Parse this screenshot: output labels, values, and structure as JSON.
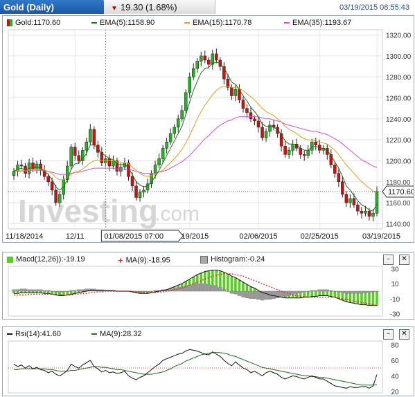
{
  "header": {
    "title": "Gold (Daily)",
    "change": "19.30 (1.68%)",
    "datetime": "03/19/2015 08:55:43"
  },
  "main_chart": {
    "legend": [
      {
        "label": "Gold:1170.60",
        "color": "#2a8b2a"
      },
      {
        "label": "EMA(5):1158.90",
        "color": "#1f6b1f"
      },
      {
        "label": "EMA(15):1170.78",
        "color": "#d8a020"
      },
      {
        "label": "EMA(35):1193.67",
        "color": "#d050d8"
      }
    ],
    "watermark": "Investing",
    "watermark_suffix": ".com",
    "last_price_label": "1170.60",
    "crosshair_label": "01/08/2015 07:00"
  },
  "macd": {
    "legend": [
      {
        "label": "Macd(12,26)):-19.19"
      },
      {
        "label": "MA(9):-18.95"
      },
      {
        "label": "Histogram:-0.24"
      }
    ]
  },
  "rsi": {
    "legend": [
      {
        "label": "Rsi(14):41.60"
      },
      {
        "label": "MA(9):28.32"
      }
    ]
  },
  "controls": {
    "minimize": "–",
    "close": "✕"
  },
  "colors": {
    "up": "#22b322",
    "down": "#d01010",
    "ema5": "#1f6b1f",
    "ema15": "#d8a020",
    "ema35": "#d050d8",
    "macd_hist": "#55d020",
    "signal": "#e03030"
  },
  "chart_data": [
    {
      "type": "candlestick",
      "title": "Gold (Daily)",
      "x_tick_labels": [
        "11/18/2014",
        "12/11",
        "01/19/2015",
        "02/06/2015",
        "02/25/2015",
        "03/19/2015"
      ],
      "ylim": [
        1135,
        1325
      ],
      "y_ticks": [
        1140,
        1160,
        1180,
        1200,
        1220,
        1240,
        1260,
        1280,
        1300,
        1320
      ],
      "close": [
        1190,
        1196,
        1195,
        1188,
        1198,
        1192,
        1197,
        1191,
        1185,
        1180,
        1172,
        1160,
        1168,
        1182,
        1195,
        1213,
        1205,
        1200,
        1210,
        1218,
        1230,
        1215,
        1208,
        1198,
        1202,
        1195,
        1200,
        1190,
        1194,
        1198,
        1185,
        1176,
        1165,
        1170,
        1172,
        1178,
        1188,
        1196,
        1202,
        1212,
        1218,
        1226,
        1232,
        1240,
        1248,
        1265,
        1280,
        1288,
        1295,
        1300,
        1296,
        1292,
        1302,
        1296,
        1290,
        1278,
        1270,
        1262,
        1268,
        1258,
        1250,
        1246,
        1240,
        1238,
        1232,
        1222,
        1228,
        1234,
        1232,
        1226,
        1214,
        1206,
        1210,
        1216,
        1212,
        1206,
        1205,
        1210,
        1218,
        1215,
        1210,
        1212,
        1206,
        1196,
        1188,
        1180,
        1168,
        1160,
        1164,
        1158,
        1152,
        1150,
        1152,
        1147,
        1150,
        1170.6
      ],
      "ema5": [
        1190,
        1192,
        1193,
        1191,
        1193,
        1193,
        1194,
        1193,
        1190,
        1187,
        1182,
        1175,
        1172,
        1175,
        1182,
        1192,
        1197,
        1198,
        1202,
        1207,
        1215,
        1215,
        1212,
        1207,
        1205,
        1202,
        1201,
        1197,
        1196,
        1197,
        1193,
        1187,
        1180,
        1177,
        1175,
        1176,
        1180,
        1185,
        1191,
        1198,
        1205,
        1212,
        1219,
        1226,
        1233,
        1244,
        1256,
        1267,
        1276,
        1284,
        1288,
        1289,
        1293,
        1294,
        1293,
        1288,
        1282,
        1275,
        1273,
        1268,
        1262,
        1257,
        1251,
        1247,
        1242,
        1235,
        1233,
        1233,
        1232,
        1230,
        1225,
        1219,
        1216,
        1216,
        1215,
        1212,
        1210,
        1210,
        1213,
        1214,
        1212,
        1212,
        1210,
        1205,
        1199,
        1193,
        1185,
        1176,
        1172,
        1167,
        1162,
        1158,
        1156,
        1153,
        1152,
        1158.9
      ],
      "ema15": [
        1190,
        1191,
        1191,
        1191,
        1192,
        1192,
        1192,
        1192,
        1191,
        1190,
        1188,
        1184,
        1182,
        1182,
        1184,
        1187,
        1189,
        1190,
        1192,
        1195,
        1198,
        1200,
        1201,
        1200,
        1200,
        1200,
        1200,
        1199,
        1198,
        1198,
        1197,
        1194,
        1191,
        1188,
        1186,
        1185,
        1186,
        1187,
        1189,
        1191,
        1195,
        1198,
        1202,
        1206,
        1211,
        1217,
        1224,
        1232,
        1240,
        1247,
        1253,
        1258,
        1263,
        1267,
        1270,
        1271,
        1271,
        1270,
        1270,
        1269,
        1267,
        1264,
        1261,
        1258,
        1254,
        1250,
        1247,
        1245,
        1243,
        1240,
        1237,
        1233,
        1230,
        1228,
        1226,
        1223,
        1221,
        1220,
        1220,
        1219,
        1218,
        1217,
        1216,
        1213,
        1210,
        1206,
        1201,
        1196,
        1192,
        1188,
        1184,
        1180,
        1177,
        1174,
        1171,
        1170.78
      ],
      "ema35": [
        1190,
        1190,
        1190,
        1190,
        1191,
        1191,
        1191,
        1191,
        1190,
        1190,
        1189,
        1188,
        1187,
        1187,
        1187,
        1188,
        1189,
        1189,
        1190,
        1191,
        1192,
        1193,
        1193,
        1193,
        1193,
        1193,
        1193,
        1192,
        1192,
        1192,
        1192,
        1191,
        1190,
        1189,
        1188,
        1188,
        1188,
        1188,
        1189,
        1190,
        1191,
        1193,
        1195,
        1197,
        1199,
        1202,
        1205,
        1209,
        1213,
        1217,
        1221,
        1224,
        1228,
        1231,
        1234,
        1236,
        1238,
        1239,
        1241,
        1242,
        1242,
        1242,
        1242,
        1242,
        1242,
        1241,
        1240,
        1240,
        1239,
        1238,
        1237,
        1235,
        1234,
        1233,
        1232,
        1231,
        1230,
        1229,
        1228,
        1228,
        1227,
        1226,
        1225,
        1223,
        1221,
        1219,
        1216,
        1213,
        1210,
        1207,
        1204,
        1201,
        1199,
        1197,
        1195,
        1193.67
      ],
      "series": [
        {
          "name": "Gold",
          "color": "#2a8b2a"
        },
        {
          "name": "EMA(5)",
          "color": "#1f6b1f"
        },
        {
          "name": "EMA(15)",
          "color": "#d8a020"
        },
        {
          "name": "EMA(35)",
          "color": "#d050d8"
        }
      ]
    },
    {
      "type": "bar",
      "title": "Macd(12,26)",
      "ylim": [
        -33,
        33
      ],
      "y_ticks": [
        30,
        10,
        -10,
        -30
      ],
      "macd": [
        -3,
        -3,
        -2,
        -2,
        -2,
        -2,
        -2,
        -2,
        -3,
        -3,
        -4,
        -5,
        -6,
        -6,
        -5,
        -4,
        -3,
        -2,
        -1,
        0,
        1,
        1,
        1,
        1,
        1,
        1,
        1,
        0,
        0,
        0,
        0,
        -1,
        -2,
        -3,
        -3,
        -3,
        -2,
        -1,
        0,
        1,
        2,
        4,
        6,
        8,
        10,
        13,
        16,
        19,
        22,
        24,
        26,
        27,
        28,
        28,
        27,
        25,
        23,
        20,
        18,
        15,
        12,
        9,
        6,
        4,
        1,
        -2,
        -3,
        -5,
        -6,
        -7,
        -8,
        -9,
        -9,
        -9,
        -9,
        -9,
        -8,
        -8,
        -7,
        -7,
        -6,
        -6,
        -6,
        -7,
        -8,
        -10,
        -12,
        -14,
        -15,
        -16,
        -17,
        -18,
        -18,
        -19,
        -19,
        -19.19
      ],
      "signal": [
        -5,
        -5,
        -5,
        -5,
        -4,
        -4,
        -4,
        -4,
        -4,
        -4,
        -4,
        -4,
        -4,
        -5,
        -5,
        -5,
        -4,
        -4,
        -3,
        -3,
        -2,
        -2,
        -1,
        -1,
        0,
        0,
        0,
        0,
        0,
        0,
        0,
        0,
        -1,
        -1,
        -2,
        -2,
        -2,
        -2,
        -1,
        -1,
        0,
        1,
        2,
        3,
        4,
        6,
        8,
        10,
        12,
        14,
        16,
        18,
        20,
        21,
        22,
        23,
        23,
        23,
        22,
        21,
        20,
        18,
        16,
        14,
        12,
        10,
        8,
        6,
        4,
        2,
        0,
        -2,
        -3,
        -5,
        -6,
        -7,
        -7,
        -8,
        -8,
        -8,
        -8,
        -8,
        -8,
        -8,
        -8,
        -9,
        -10,
        -11,
        -12,
        -13,
        -14,
        -15,
        -16,
        -17,
        -18,
        -18.95
      ],
      "histogram_label": "Histogram:-0.24"
    },
    {
      "type": "line",
      "title": "Rsi(14)",
      "ylim": [
        18,
        85
      ],
      "y_ticks": [
        80,
        60,
        40,
        20
      ],
      "reference_line": 50,
      "rsi": [
        55,
        52,
        54,
        50,
        53,
        49,
        51,
        48,
        47,
        44,
        46,
        42,
        40,
        43,
        47,
        55,
        52,
        50,
        54,
        57,
        60,
        52,
        49,
        45,
        47,
        44,
        45,
        43,
        44,
        46,
        40,
        37,
        35,
        38,
        40,
        44,
        48,
        52,
        55,
        60,
        62,
        64,
        66,
        68,
        69,
        72,
        74,
        73,
        72,
        70,
        68,
        67,
        71,
        68,
        65,
        60,
        56,
        53,
        58,
        54,
        50,
        48,
        44,
        46,
        43,
        40,
        44,
        46,
        44,
        42,
        38,
        36,
        38,
        40,
        39,
        37,
        36,
        38,
        40,
        38,
        36,
        36,
        33,
        30,
        27,
        26,
        25,
        24,
        26,
        25,
        25,
        26,
        26,
        24,
        27,
        41.6
      ],
      "rsi_ma": [
        48,
        48,
        49,
        49,
        49,
        49,
        49,
        49,
        49,
        48,
        48,
        47,
        46,
        46,
        46,
        47,
        47,
        48,
        49,
        50,
        51,
        52,
        52,
        51,
        51,
        50,
        49,
        48,
        48,
        47,
        46,
        45,
        44,
        43,
        42,
        42,
        42,
        43,
        44,
        45,
        47,
        49,
        52,
        54,
        56,
        59,
        61,
        63,
        65,
        67,
        68,
        69,
        70,
        70,
        70,
        69,
        68,
        66,
        65,
        63,
        61,
        59,
        57,
        55,
        53,
        51,
        50,
        49,
        48,
        47,
        46,
        45,
        44,
        43,
        42,
        41,
        40,
        40,
        39,
        39,
        38,
        38,
        37,
        36,
        35,
        34,
        33,
        32,
        31,
        30,
        29,
        28,
        28,
        28,
        28,
        28.32
      ]
    }
  ]
}
